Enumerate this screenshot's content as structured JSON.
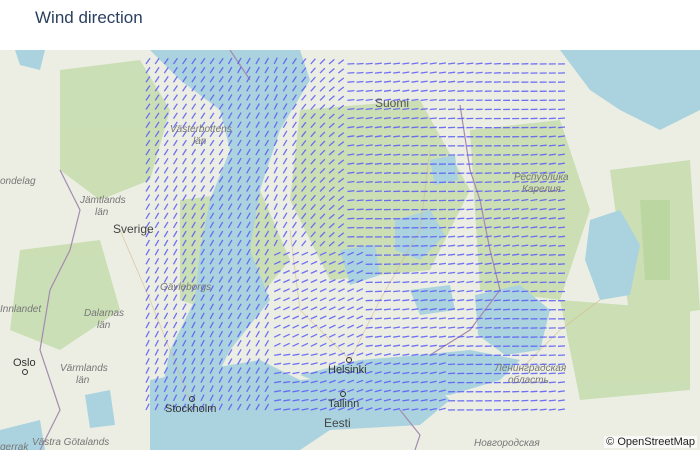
{
  "title": "Wind direction",
  "attribution": "© OpenStreetMap",
  "colors": {
    "wind_arrow": "#5b5bf5",
    "water": "#aad3df",
    "land": "#eceee3",
    "forest": "#c8ddb0",
    "border": "#a58ab0",
    "label": "#555555"
  },
  "places": {
    "suomi": "Suomi",
    "sverige": "Sverige",
    "eesti": "Eesti",
    "helsinki": "Helsinki",
    "tallinn": "Tallinn",
    "stockholm": "Stockholm",
    "oslo": "Oslo",
    "jamtlands": "Jämtlands",
    "lan1": "län",
    "vasterbottens": "Västerbottens",
    "lan2": "län",
    "dalarnas": "Dalarnas",
    "lan3": "län",
    "varmlands": "Värmlands",
    "lan4": "län",
    "innlandet": "Innlandet",
    "ondelag": "ondelag",
    "gavleborgs": "Gävleborgs",
    "vastra_gotalands": "Västra Götalands",
    "karelia1": "Республика",
    "karelia2": "Карелия",
    "lenobl1": "Ленинградская",
    "lenobl2": "область",
    "novgorod": "Новгородская",
    "gerrak": "gerrak"
  }
}
